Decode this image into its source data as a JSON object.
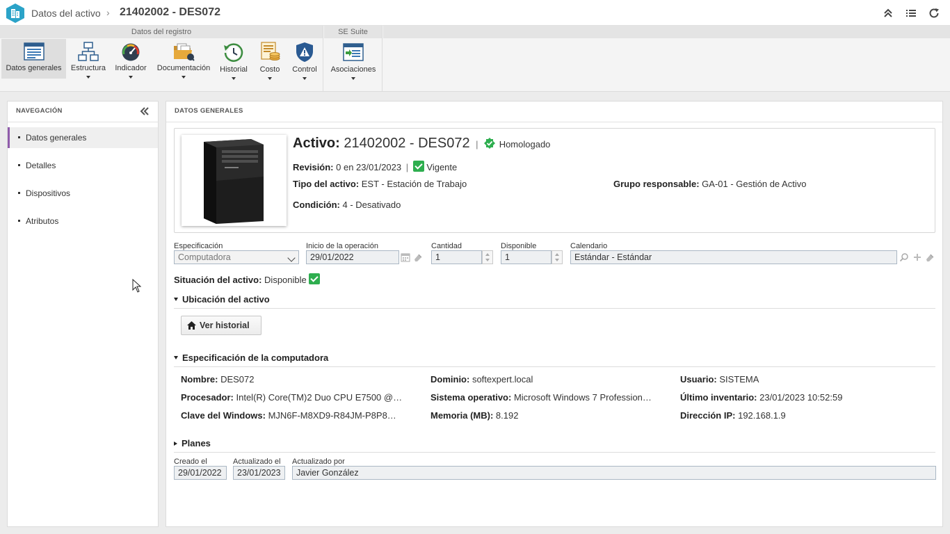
{
  "titlebar": {
    "breadcrumb": "Datos del activo",
    "separator": "›",
    "title": "21402002 - DES072"
  },
  "ribbon": {
    "groups": [
      {
        "label": "Datos del registro"
      },
      {
        "label": "SE Suite"
      }
    ],
    "buttons": [
      {
        "label": "Datos generales",
        "icon": "form-icon",
        "has_menu": false,
        "active": true
      },
      {
        "label": "Estructura",
        "icon": "structure-icon",
        "has_menu": true
      },
      {
        "label": "Indicador",
        "icon": "gauge-icon",
        "has_menu": true
      },
      {
        "label": "Documentación",
        "icon": "folder-icon",
        "has_menu": true
      },
      {
        "label": "Historial",
        "icon": "history-clock-icon",
        "has_menu": true
      },
      {
        "label": "Costo",
        "icon": "cost-icon",
        "has_menu": true
      },
      {
        "label": "Control",
        "icon": "shield-alert-icon",
        "has_menu": true
      },
      {
        "label": "Asociaciones",
        "icon": "associations-icon",
        "has_menu": true
      }
    ]
  },
  "nav": {
    "header": "NAVEGACIÓN",
    "items": [
      {
        "label": "Datos generales",
        "active": true
      },
      {
        "label": "Detalles"
      },
      {
        "label": "Dispositivos"
      },
      {
        "label": "Atributos"
      }
    ]
  },
  "main": {
    "header": "DATOS GENERALES",
    "asset": {
      "title_label": "Activo:",
      "title_value": "21402002 - DES072",
      "separator": "|",
      "approval_status": "Homologado",
      "revision_label": "Revisión:",
      "revision_value": "0 en 23/01/2023",
      "revision_status": "Vigente",
      "type_label": "Tipo del activo:",
      "type_value": "EST - Estación de Trabajo",
      "group_label": "Grupo responsable:",
      "group_value": "GA-01 - Gestión de Activo",
      "condition_label": "Condición:",
      "condition_value": "4 - Desativado"
    },
    "fields": {
      "specification": {
        "label": "Especificación",
        "value": "Computadora"
      },
      "operation_start": {
        "label": "Inicio de la operación",
        "value": "29/01/2022"
      },
      "quantity": {
        "label": "Cantidad",
        "value": "1"
      },
      "available": {
        "label": "Disponible",
        "value": "1"
      },
      "calendar": {
        "label": "Calendario",
        "value": "Estándar - Estándar"
      }
    },
    "situation": {
      "label": "Situación del activo:",
      "value": "Disponible"
    },
    "location": {
      "title": "Ubicación del activo",
      "history_button": "Ver historial"
    },
    "computer_spec": {
      "title": "Especificación de la computadora",
      "rows": [
        [
          {
            "label": "Nombre:",
            "value": "DES072"
          },
          {
            "label": "Dominio:",
            "value": "softexpert.local"
          },
          {
            "label": "Usuario:",
            "value": "SISTEMA"
          }
        ],
        [
          {
            "label": "Procesador:",
            "value": "Intel(R) Core(TM)2 Duo CPU E7500 @…"
          },
          {
            "label": "Sistema operativo:",
            "value": "Microsoft Windows 7 Profession…"
          },
          {
            "label": "Último inventario:",
            "value": "23/01/2023 10:52:59"
          }
        ],
        [
          {
            "label": "Clave del Windows:",
            "value": "MJN6F-M8XD9-R84JM-P8P8…"
          },
          {
            "label": "Memoria (MB):",
            "value": "8.192"
          },
          {
            "label": "Dirección IP:",
            "value": "192.168.1.9"
          }
        ]
      ]
    },
    "plans": {
      "title": "Planes"
    },
    "audit": {
      "created": {
        "label": "Creado el",
        "value": "29/01/2022"
      },
      "updated": {
        "label": "Actualizado el",
        "value": "23/01/2023"
      },
      "updated_by": {
        "label": "Actualizado por",
        "value": "Javier González"
      }
    }
  },
  "colors": {
    "accent_nav": "#8f5bab",
    "ok_green": "#2eae4f",
    "logo_blue": "#2ba3c8"
  }
}
